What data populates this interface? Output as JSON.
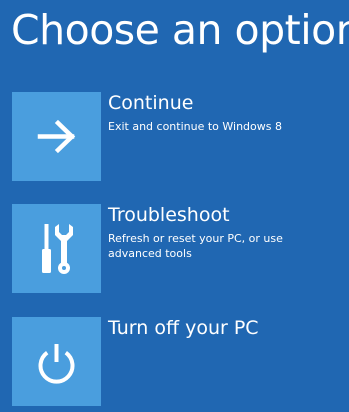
{
  "page": {
    "title": "Choose an option"
  },
  "options": [
    {
      "title": "Continue",
      "description": "Exit and continue to Windows 8",
      "icon": "arrow-right-icon"
    },
    {
      "title": "Troubleshoot",
      "description": "Refresh or reset your PC, or use advanced tools",
      "icon": "tools-icon"
    },
    {
      "title": "Turn off your PC",
      "description": "",
      "icon": "power-icon"
    }
  ],
  "colors": {
    "background": "#2067b2",
    "tile": "#4a9ede",
    "text": "#ffffff"
  }
}
